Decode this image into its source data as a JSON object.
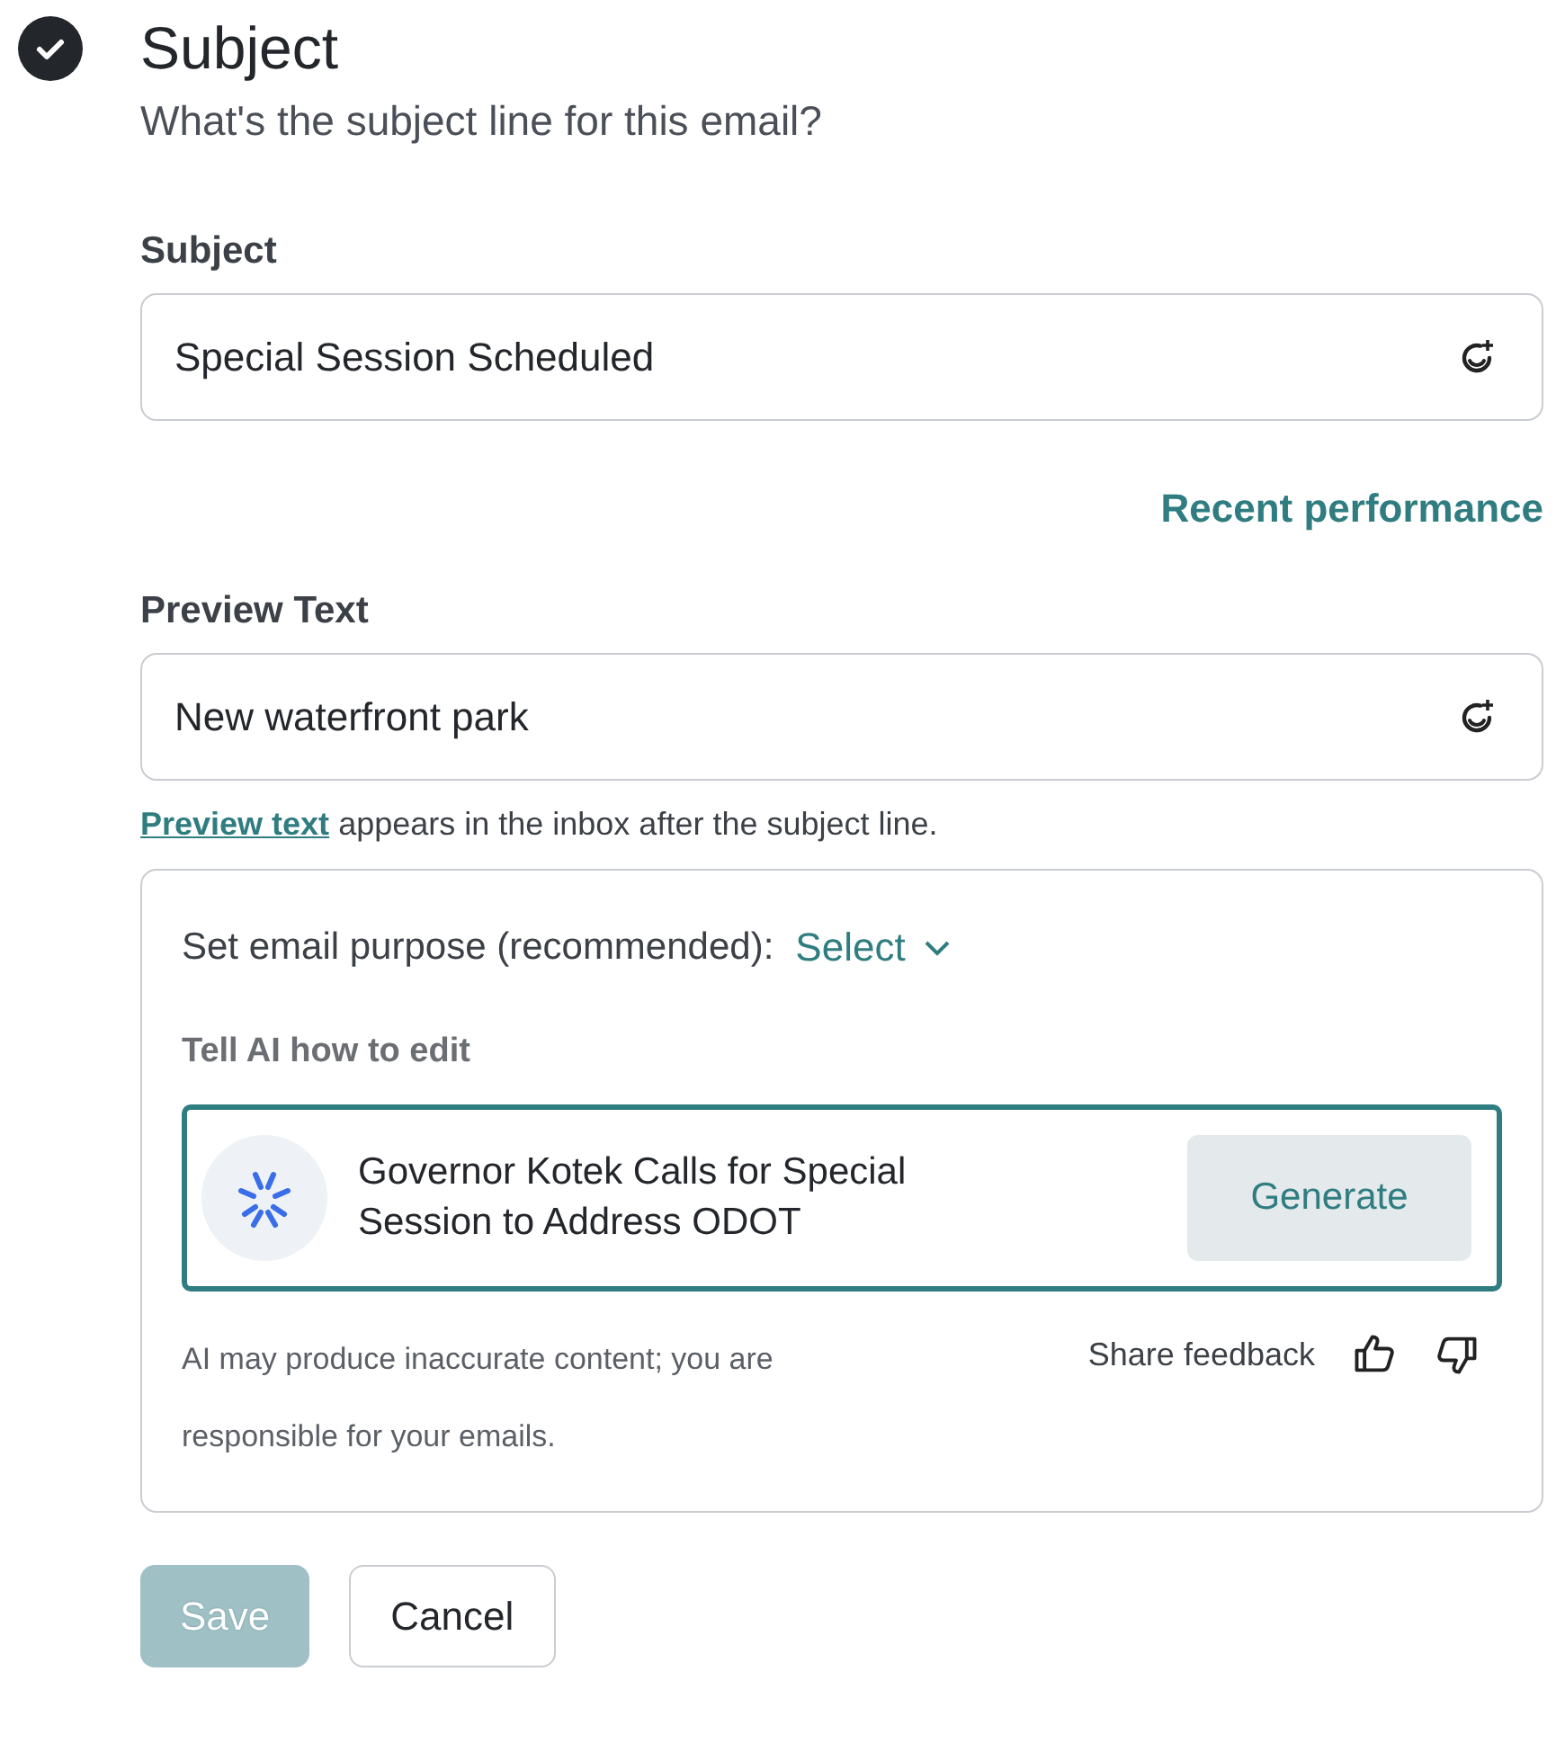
{
  "step": {
    "completed": true,
    "title": "Subject",
    "subtitle": "What's the subject line for this email?"
  },
  "fields": [
    {
      "label": "Subject",
      "value": "Special Session Scheduled",
      "link": "Recent performance"
    },
    {
      "label": "Preview Text",
      "value": "New waterfront park",
      "help_link": "Preview text",
      "help": " appears in the inbox after the subject line."
    }
  ],
  "ai_panel": {
    "purpose_label": "Set email purpose (recommended):",
    "purpose_value": "Select",
    "edit_label": "Tell AI how to edit",
    "prompt": "Governor Kotek Calls for Special Session to Address ODOT",
    "generate": "Generate",
    "disclaimer": "AI may produce inaccurate content; you are responsible for your emails.",
    "feedback": "Share feedback"
  },
  "buttons": [
    {
      "label": "Save",
      "kind": "primary",
      "disabled": true
    },
    {
      "label": "Cancel",
      "kind": "secondary",
      "disabled": false
    }
  ]
}
